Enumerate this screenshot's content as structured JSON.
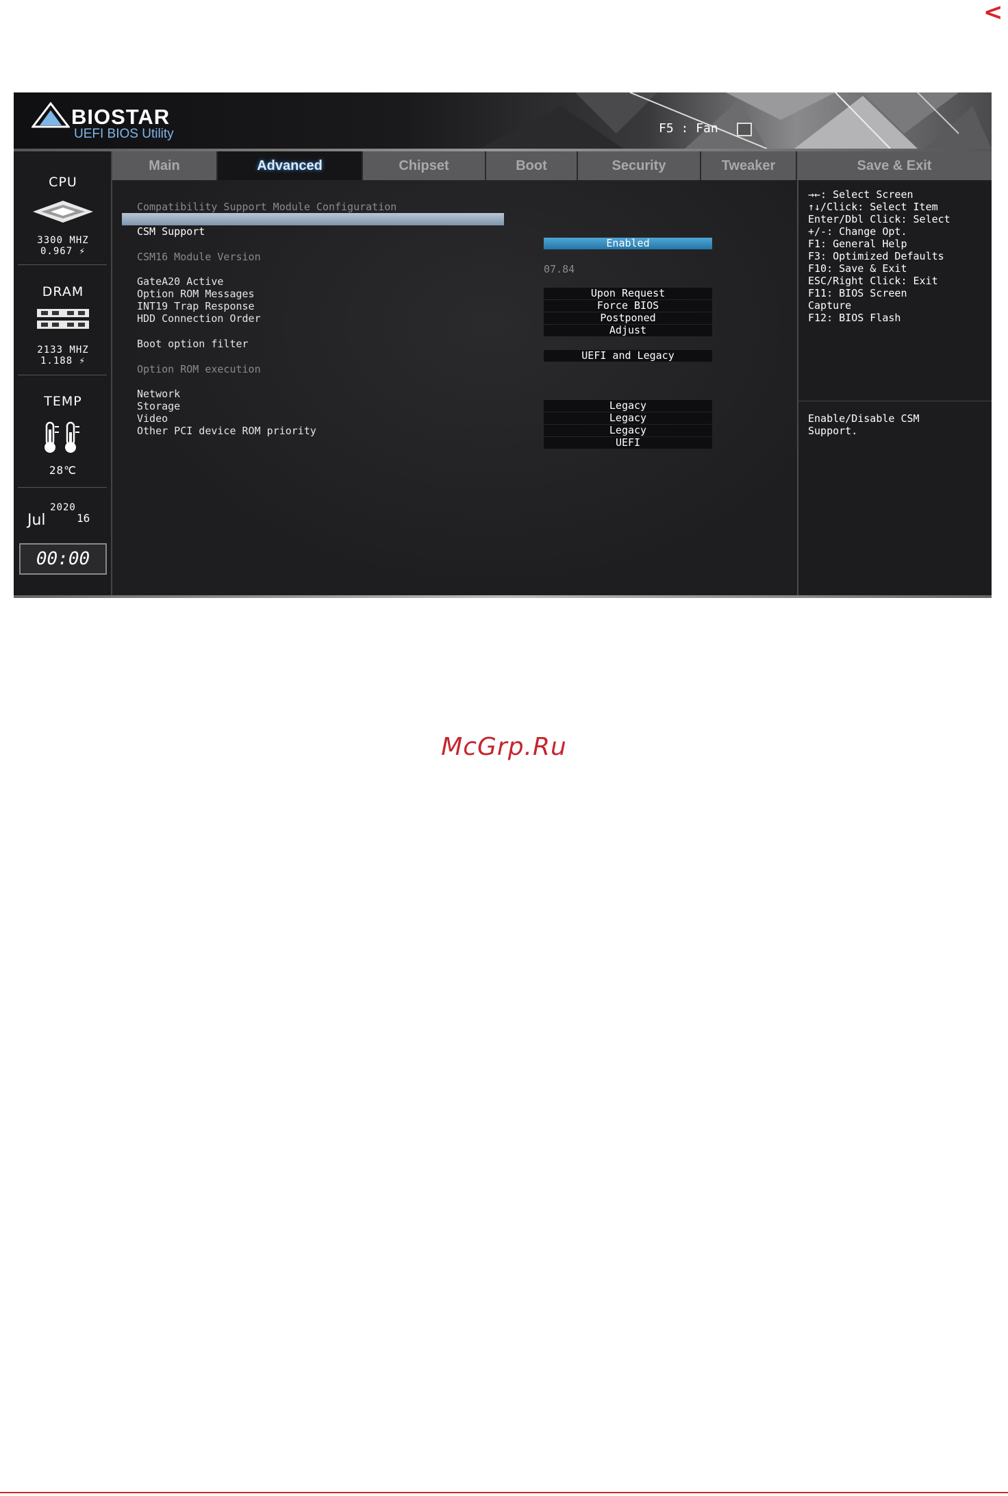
{
  "nav": {
    "back_glyph": "<"
  },
  "header": {
    "brand": "BIOSTAR",
    "subtitle": "UEFI BIOS Utility",
    "fan_hint": "F5 : Fan",
    "fan_icon": "fan-icon"
  },
  "side": {
    "cpu": {
      "title": "CPU",
      "freq": "3300 MHZ",
      "volt": "0.967 ⚡"
    },
    "dram": {
      "title": "DRAM",
      "freq": "2133 MHZ",
      "volt": "1.188 ⚡"
    },
    "temp": {
      "title": "TEMP",
      "value": "28℃"
    },
    "date": {
      "year": "2020",
      "month": "Jul",
      "day": "16"
    },
    "clock": "00:00"
  },
  "tabs": [
    {
      "label": "Main"
    },
    {
      "label": "Advanced"
    },
    {
      "label": "Chipset"
    },
    {
      "label": "Boot"
    },
    {
      "label": "Security"
    },
    {
      "label": "Tweaker"
    },
    {
      "label": "Save & Exit"
    }
  ],
  "main": {
    "section_title": "Compatibility Support Module Configuration",
    "csm_support": {
      "label": "CSM Support",
      "value": "Enabled"
    },
    "csm16": {
      "label": "CSM16 Module Version",
      "value": "07.84"
    },
    "gatea20": {
      "label": "GateA20 Active",
      "value": "Upon Request"
    },
    "option_rom_messages": {
      "label": "Option ROM Messages",
      "value": "Force BIOS"
    },
    "int19": {
      "label": "INT19 Trap Response",
      "value": "Postponed"
    },
    "hdd_order": {
      "label": "HDD Connection Order",
      "value": "Adjust"
    },
    "boot_filter": {
      "label": "Boot option filter",
      "value": "UEFI and Legacy"
    },
    "option_rom_exec": "Option ROM execution",
    "network": {
      "label": "Network",
      "value": "Legacy"
    },
    "storage": {
      "label": "Storage",
      "value": "Legacy"
    },
    "video": {
      "label": "Video",
      "value": "Legacy"
    },
    "other_pci": {
      "label": "Other PCI device ROM priority",
      "value": "UEFI"
    }
  },
  "help": {
    "keys": [
      "→←: Select Screen",
      "↑↓/Click: Select Item",
      "Enter/Dbl Click: Select",
      "+/-: Change Opt.",
      "F1: General Help",
      "F3: Optimized Defaults",
      "F10: Save & Exit",
      "ESC/Right Click: Exit",
      "F11: BIOS Screen",
      "Capture",
      "F12: BIOS Flash"
    ],
    "desc_line1": "Enable/Disable CSM",
    "desc_line2": "Support."
  },
  "watermark": "McGrp.Ru",
  "colors": {
    "accent": "#d9232d",
    "selection": "#2f86bf",
    "watermark": "#c6262e"
  }
}
